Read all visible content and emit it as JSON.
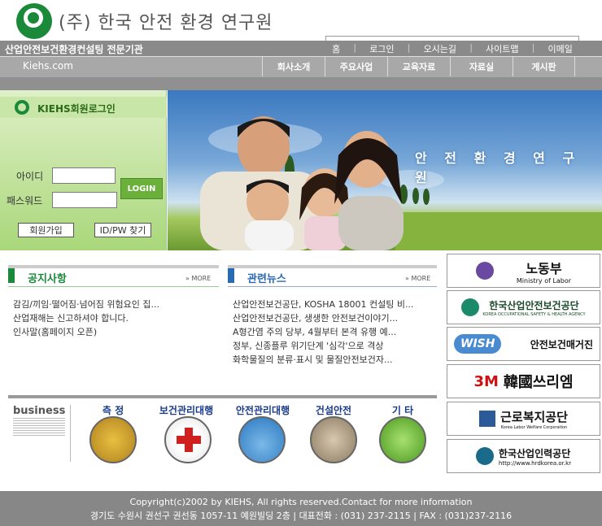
{
  "header": {
    "logo_text": "(주) 한국 안전 환경 연구원",
    "tagline": "산업안전보건환경컨설팅 전문기관",
    "site_name": "Kiehs.com"
  },
  "util_nav": [
    "홈",
    "로그인",
    "오시는길",
    "사이트맵",
    "이메일"
  ],
  "main_nav": [
    "회사소개",
    "주요사업",
    "교육자료",
    "자료실",
    "게시판"
  ],
  "login": {
    "title": "KIEHS회원로그인",
    "id_label": "아이디",
    "pw_label": "패스워드",
    "login_button": "LOGIN",
    "join_button": "회원가입",
    "find_button": "ID/PW 찾기"
  },
  "hero": {
    "title": "안 전 환 경 연 구 원"
  },
  "notice": {
    "title": "공지사항",
    "more": "MORE",
    "items": [
      "감김/끼임·떨어짐·넘어짐 위험요인 집...",
      "산업재해는 신고하셔야 합니다.",
      "인사말(홈페이지 오픈)"
    ]
  },
  "news": {
    "title": "관련뉴스",
    "more": "MORE",
    "items": [
      "산업안전보건공단, KOSHA 18001 컨설팅 비...",
      "산업안전보건공단, 생생한 안전보건이야기...",
      "A형간염 주의 당부, 4월부터 본격 유행 예...",
      "정부, 신종플루 위기단계 '심각'으로 격상",
      "화학물질의 분류·표시 및 물질안전보건자..."
    ]
  },
  "business": {
    "title": "business",
    "items": [
      "측 정",
      "보건관리대행",
      "안전관리대행",
      "건설안전",
      "기 타"
    ]
  },
  "banners": [
    {
      "title": "노동부",
      "sub": "Ministry of Labor"
    },
    {
      "title": "한국산업안전보건공단",
      "sub": "KOREA OCCUPATIONAL SAFETY & HEALTH AGENCY"
    },
    {
      "title": "안전보건매거진",
      "sub": "WISH"
    },
    {
      "title": "韓國쓰리엠",
      "sub": "3M"
    },
    {
      "title": "근로복지공단",
      "sub": "Korea Labor Welfare Corporation"
    },
    {
      "title": "한국산업인력공단",
      "sub": "http://www.hrdkorea.or.kr"
    }
  ],
  "footer": {
    "line1": "Copyright(c)2002 by KIEHS, All rights reserved.Contact for more information",
    "line2": "경기도 수원시 권선구 권선동 1057-11 예원빌딩 2층 | 대표전화 : (031) 237-2115 | FAX : (031)237-2116"
  },
  "colors": {
    "brand_green": "#1a8a3a",
    "nav_gray": "#a8a8a8",
    "notice_green": "#1a8a3a",
    "news_blue": "#2a6ab0"
  }
}
